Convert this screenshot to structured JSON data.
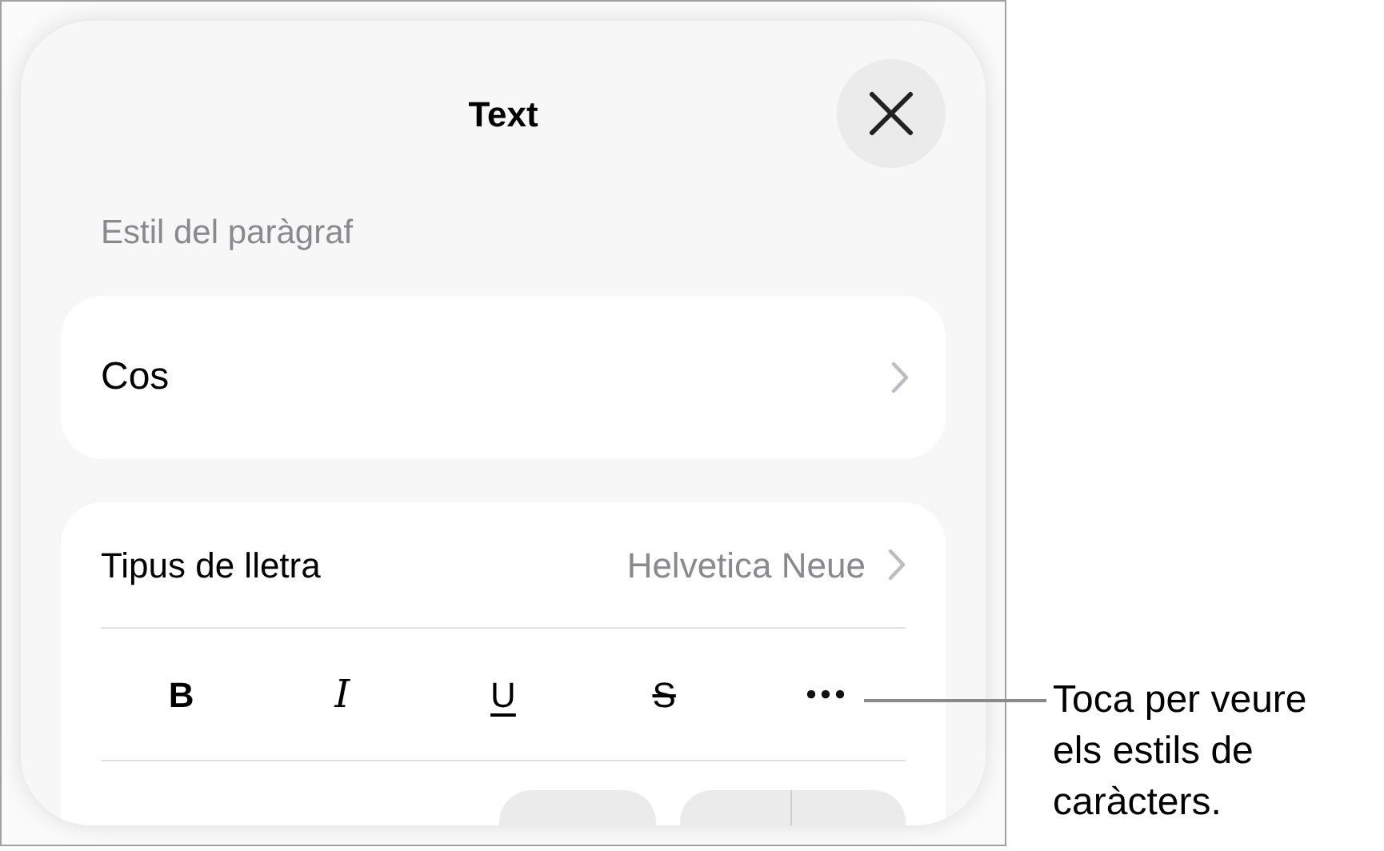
{
  "panel": {
    "title": "Text"
  },
  "paragraph_style": {
    "header": "Estil del paràgraf",
    "value": "Cos"
  },
  "font": {
    "label": "Tipus de lletra",
    "value": "Helvetica Neue"
  },
  "styles": [
    {
      "kind": "bold",
      "label": "B"
    },
    {
      "kind": "italic",
      "label": "I"
    },
    {
      "kind": "underline",
      "label": "U"
    },
    {
      "kind": "strikethrough",
      "label": "S"
    },
    {
      "kind": "more"
    }
  ],
  "callout": "Toca per veure els estils de caràcters."
}
